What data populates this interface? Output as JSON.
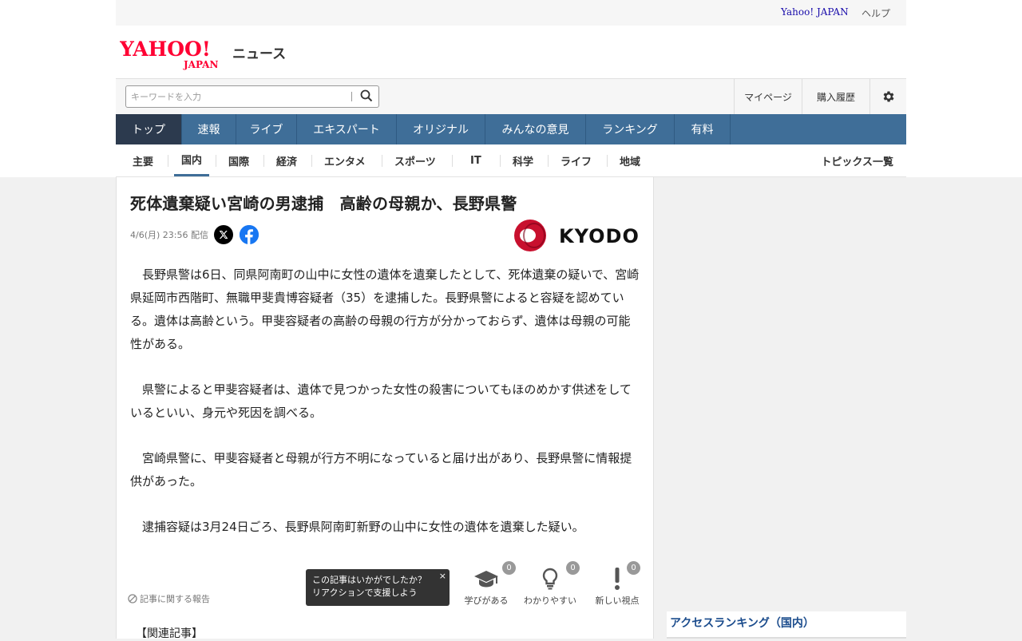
{
  "util": {
    "yahoo_japan": "Yahoo! JAPAN",
    "help": "ヘルプ"
  },
  "logo": {
    "brand_top": "YAHOO!",
    "brand_bottom": "JAPAN",
    "service": "ニュース",
    "color": "#ff0033"
  },
  "search": {
    "placeholder": "キーワードを入力"
  },
  "user_links": {
    "mypage": "マイページ",
    "history": "購入履歴"
  },
  "main_nav": [
    {
      "label": "トップ",
      "active": true
    },
    {
      "label": "速報"
    },
    {
      "label": "ライブ"
    },
    {
      "label": "エキスパート"
    },
    {
      "label": "オリジナル"
    },
    {
      "label": "みんなの意見"
    },
    {
      "label": "ランキング"
    },
    {
      "label": "有料"
    }
  ],
  "sub_nav": [
    {
      "label": "主要"
    },
    {
      "label": "国内",
      "active": true
    },
    {
      "label": "国際"
    },
    {
      "label": "経済"
    },
    {
      "label": "エンタメ"
    },
    {
      "label": "スポーツ"
    },
    {
      "label": "IT"
    },
    {
      "label": "科学"
    },
    {
      "label": "ライフ"
    },
    {
      "label": "地域"
    }
  ],
  "sub_nav_right": "トピックス一覧",
  "article": {
    "title": "死体遺棄疑い宮崎の男逮捕　高齢の母親か、長野県警",
    "date": "4/6(月) 23:56 配信",
    "source": "KYODO",
    "paragraphs": [
      "長野県警は6日、同県阿南町の山中に女性の遺体を遺棄したとして、死体遺棄の疑いで、宮崎県延岡市西階町、無職甲斐貴博容疑者（35）を逮捕した。長野県警によると容疑を認めている。遺体は高齢という。甲斐容疑者の高齢の母親の行方が分かっておらず、遺体は母親の可能性がある。",
      "県警によると甲斐容疑者は、遺体で見つかった女性の殺害についてもほのめかす供述をしているといい、身元や死因を調べる。",
      "宮崎県警に、甲斐容疑者と母親が行方不明になっていると届け出があり、長野県警に情報提供があった。",
      "逮捕容疑は3月24日ごろ、長野県阿南町新野の山中に女性の遺体を遺棄した疑い。"
    ],
    "report_label": "記事に関する報告",
    "tooltip_line1": "この記事はいかがでしたか？",
    "tooltip_line2": "リアクションで支援しよう",
    "tooltip_close": "×",
    "reactions": [
      {
        "label": "学びがある",
        "count": "0",
        "icon": "graduation-cap-icon"
      },
      {
        "label": "わかりやすい",
        "count": "0",
        "icon": "lightbulb-icon"
      },
      {
        "label": "新しい視点",
        "count": "0",
        "icon": "exclamation-icon"
      }
    ],
    "related": "【関連記事】"
  },
  "sidebar": {
    "ranking_title": "アクセスランキング（国内）"
  },
  "colors": {
    "nav_bg": "#3f6e98",
    "nav_active": "#2c3a4e",
    "kyodo_red": "#c8102e",
    "link": "#1a0dab"
  }
}
